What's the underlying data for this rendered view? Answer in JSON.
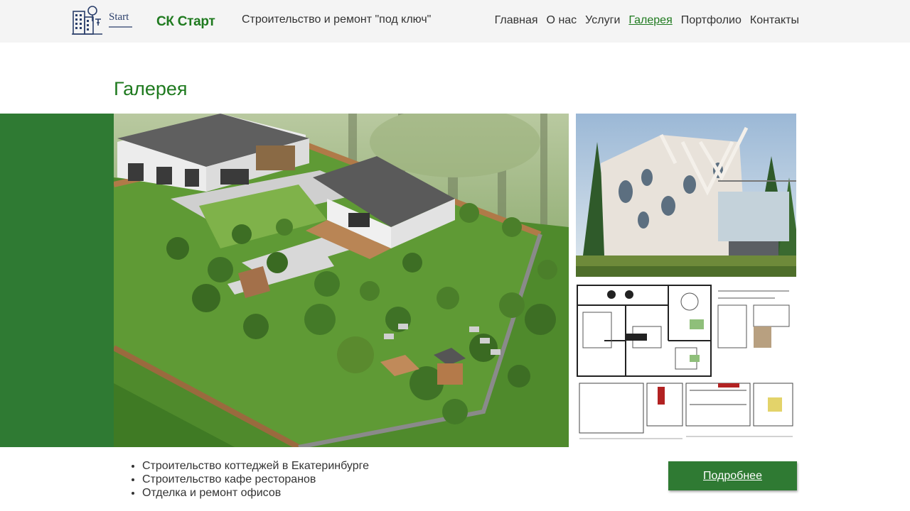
{
  "header": {
    "logo_text": "Start",
    "brand": "СК Старт",
    "tagline": "Строительство и ремонт \"под ключ\"",
    "nav": [
      {
        "label": "Главная",
        "active": false
      },
      {
        "label": "О нас",
        "active": false
      },
      {
        "label": "Услуги",
        "active": false
      },
      {
        "label": "Галерея",
        "active": true
      },
      {
        "label": "Портфолио",
        "active": false
      },
      {
        "label": "Контакты",
        "active": false
      }
    ]
  },
  "main": {
    "title": "Галерея",
    "gallery": [
      {
        "icon": "cottage-render-image"
      },
      {
        "icon": "modern-house-image"
      },
      {
        "icon": "floor-plan-image"
      }
    ],
    "services": [
      "Строительство коттеджей в Екатеринбурге",
      "Строительство кафе ресторанов",
      "Отделка и ремонт офисов"
    ],
    "more_button": "Подробнее"
  },
  "colors": {
    "accent": "#1f7a1f",
    "green_block": "#2f7a33",
    "header_bg": "#f4f4f4",
    "text": "#333333"
  }
}
